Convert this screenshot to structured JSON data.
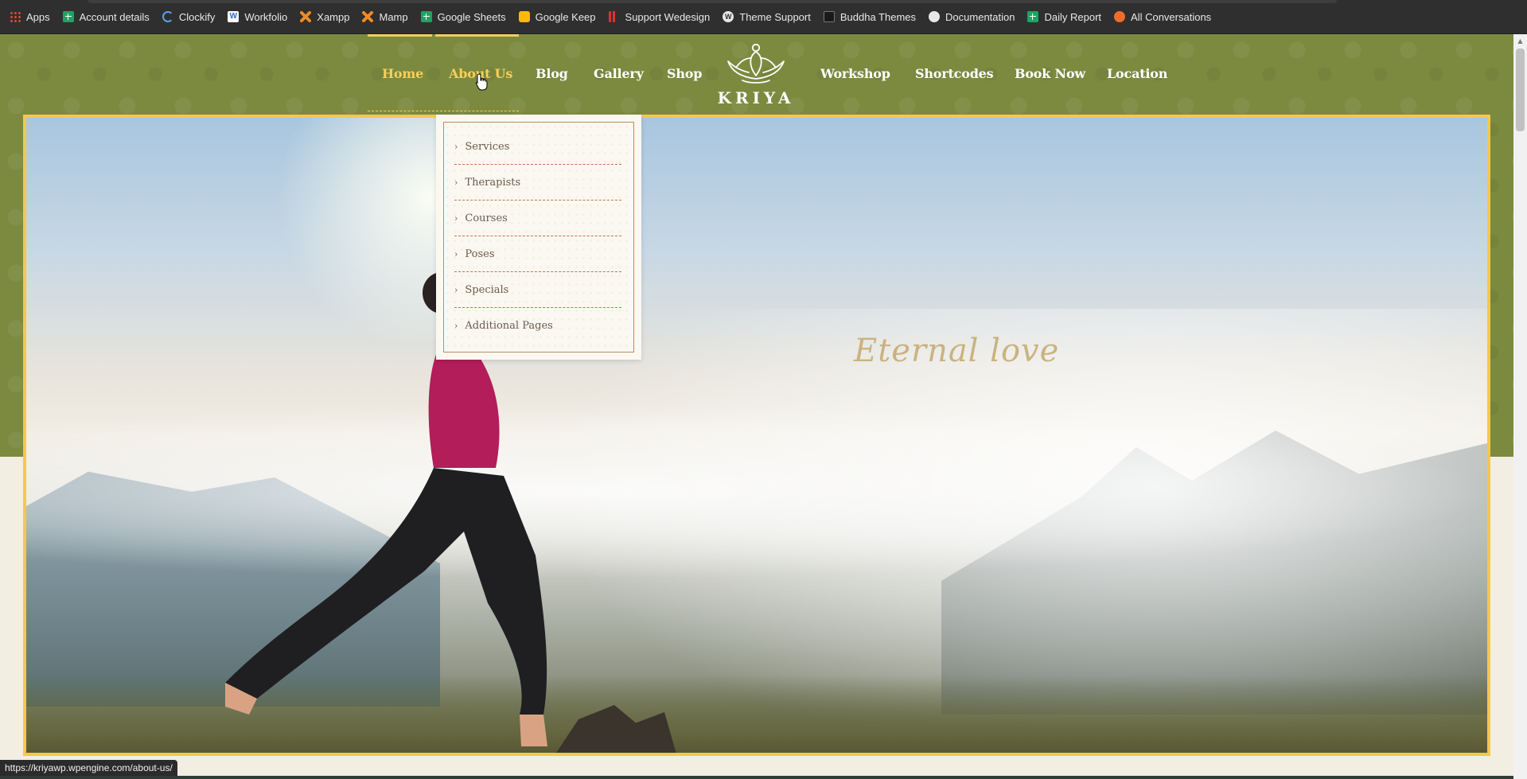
{
  "bookmarks": [
    {
      "label": "Apps",
      "icon": "apps-icon"
    },
    {
      "label": "Account details",
      "icon": "google-sheets-icon"
    },
    {
      "label": "Clockify",
      "icon": "clockify-icon"
    },
    {
      "label": "Workfolio",
      "icon": "workfolio-icon"
    },
    {
      "label": "Xampp",
      "icon": "xampp-icon"
    },
    {
      "label": "Mamp",
      "icon": "mamp-icon"
    },
    {
      "label": "Google Sheets",
      "icon": "google-sheets-icon"
    },
    {
      "label": "Google Keep",
      "icon": "google-keep-icon"
    },
    {
      "label": "Support Wedesign",
      "icon": "wedesign-icon"
    },
    {
      "label": "Theme Support",
      "icon": "wordpress-icon"
    },
    {
      "label": "Buddha Themes",
      "icon": "buddha-themes-icon"
    },
    {
      "label": "Documentation",
      "icon": "documentation-icon"
    },
    {
      "label": "Daily Report",
      "icon": "google-sheets-icon"
    },
    {
      "label": "All Conversations",
      "icon": "conversations-icon"
    }
  ],
  "nav": {
    "home": "Home",
    "about": "About Us",
    "blog": "Blog",
    "gallery": "Gallery",
    "shop": "Shop",
    "workshop": "Workshop",
    "shortcodes": "Shortcodes",
    "book": "Book Now",
    "location": "Location"
  },
  "logo": {
    "text": "KRIYA"
  },
  "dropdown": {
    "items": [
      {
        "label": "Services"
      },
      {
        "label": "Therapists"
      },
      {
        "label": "Courses"
      },
      {
        "label": "Poses"
      },
      {
        "label": "Specials"
      },
      {
        "label": "Additional Pages"
      }
    ]
  },
  "hero": {
    "tagline": "Eternal love"
  },
  "status": {
    "url": "https://kriyawp.wpengine.com/about-us/"
  },
  "colors": {
    "header": "#7b8a3f",
    "accent": "#f6cf5c",
    "border": "#f1c94d"
  }
}
